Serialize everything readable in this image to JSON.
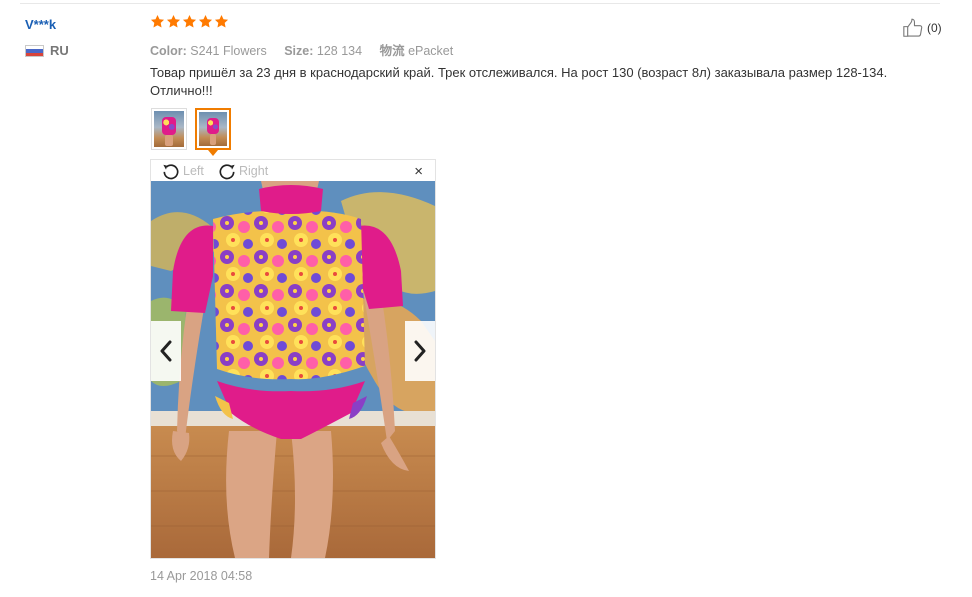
{
  "user": {
    "name": "V***k",
    "country": "RU"
  },
  "review": {
    "rating": 5,
    "rating_max": 5,
    "color_label": "Color:",
    "color_value": "S241 Flowers",
    "size_label": "Size:",
    "size_value": "128 134",
    "shipping_label": "物流",
    "shipping_value": "ePacket",
    "text": "Товар пришёл за 23 дня в краснодарский край. Трек отслеживался. На рост 130 (возраст 8л) заказывала размер 128-134. Отлично!!!",
    "date": "14 Apr 2018 04:58",
    "helpful_count": "(0)"
  },
  "viewer": {
    "rotate_left_label": "Left",
    "rotate_right_label": "Right",
    "close_label": "×",
    "thumbnail_count": 2,
    "active_thumbnail": 2
  },
  "colors": {
    "star": "#ff7a00",
    "username": "#1a5fb4",
    "active_thumb_border": "#f07c00",
    "swimsuit": "#e01c8a"
  },
  "icons": {
    "helpful": "thumbs-up-icon",
    "prev": "chevron-left-icon",
    "next": "chevron-right-icon",
    "rotate_left": "rotate-left-icon",
    "rotate_right": "rotate-right-icon",
    "close": "close-icon",
    "flag": "russia-flag-icon"
  }
}
